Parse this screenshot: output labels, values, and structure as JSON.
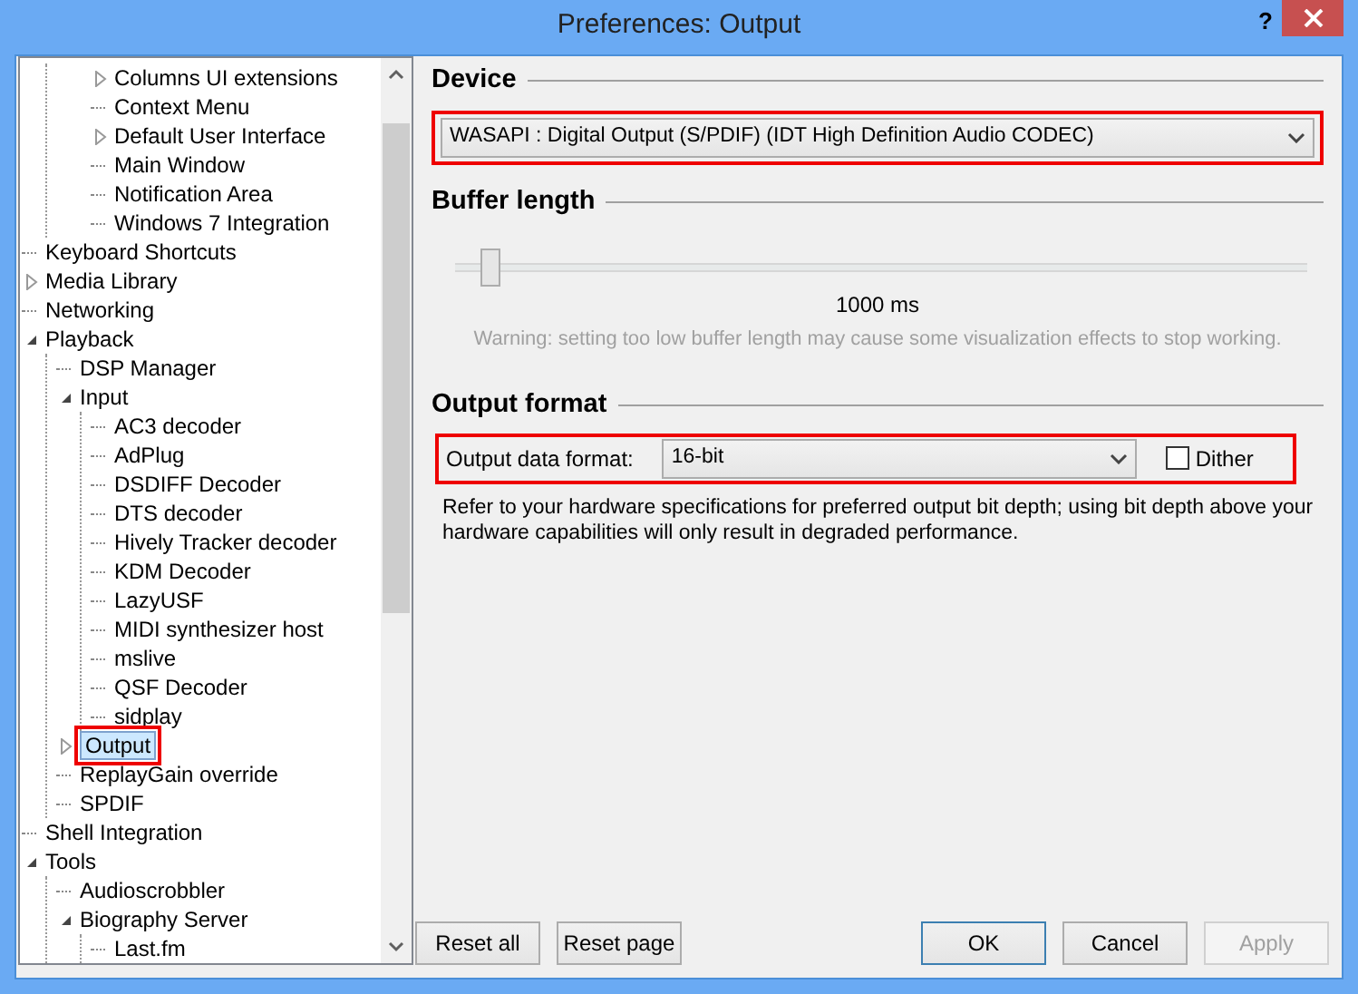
{
  "window": {
    "title": "Preferences: Output",
    "help_glyph": "?"
  },
  "tree": {
    "items": [
      {
        "children": [
          {
            "label": "Columns UI extensions",
            "expanded": false,
            "selected": false
          },
          {
            "label": "Context Menu",
            "selected": false
          },
          {
            "label": "Default User Interface",
            "expanded": false,
            "selected": false
          },
          {
            "label": "Main Window",
            "selected": false
          },
          {
            "label": "Notification Area",
            "selected": false
          },
          {
            "label": "Windows 7 Integration",
            "selected": false
          }
        ]
      },
      {
        "label": "Keyboard Shortcuts",
        "selected": false
      },
      {
        "label": "Media Library",
        "expanded": false,
        "selected": false
      },
      {
        "label": "Networking",
        "selected": false
      },
      {
        "label": "Playback",
        "expanded": true,
        "selected": false,
        "children": [
          {
            "label": "DSP Manager",
            "selected": false
          },
          {
            "label": "Input",
            "expanded": true,
            "selected": false,
            "children": [
              {
                "label": "AC3 decoder",
                "selected": false
              },
              {
                "label": "AdPlug",
                "selected": false
              },
              {
                "label": "DSDIFF Decoder",
                "selected": false
              },
              {
                "label": "DTS decoder",
                "selected": false
              },
              {
                "label": "Hively Tracker decoder",
                "selected": false
              },
              {
                "label": "KDM Decoder",
                "selected": false
              },
              {
                "label": "LazyUSF",
                "selected": false
              },
              {
                "label": "MIDI synthesizer host",
                "selected": false
              },
              {
                "label": "mslive",
                "selected": false
              },
              {
                "label": "QSF Decoder",
                "selected": false
              },
              {
                "label": "sidplay",
                "selected": false
              }
            ]
          },
          {
            "label": "Output",
            "expanded": false,
            "selected": true,
            "highlighted": true
          },
          {
            "label": "ReplayGain override",
            "selected": false
          },
          {
            "label": "SPDIF",
            "selected": false
          }
        ]
      },
      {
        "label": "Shell Integration",
        "selected": false
      },
      {
        "label": "Tools",
        "expanded": true,
        "selected": false,
        "children": [
          {
            "label": "Audioscrobbler",
            "selected": false
          },
          {
            "label": "Biography Server",
            "expanded": true,
            "selected": false,
            "children": [
              {
                "label": "Last.fm",
                "selected": false
              }
            ]
          }
        ]
      }
    ]
  },
  "device": {
    "heading": "Device",
    "value": "WASAPI : Digital Output (S/PDIF) (IDT High Definition Audio CODEC)",
    "highlighted": true
  },
  "buffer": {
    "heading": "Buffer length",
    "level": 0.04,
    "reading": "1000 ms",
    "warning": "Warning: setting too low buffer length may cause some visualization effects to stop working."
  },
  "output_format": {
    "heading": "Output format",
    "label": "Output data format:",
    "value": "16-bit",
    "dither": {
      "label": "Dither",
      "checked": false
    },
    "highlighted": true,
    "note": "Refer to your hardware specifications for preferred output bit depth; using bit depth above your hardware capabilities will only result in degraded performance."
  },
  "buttons": [
    {
      "label": "Reset all",
      "kind": "left",
      "focused": false,
      "disabled": false
    },
    {
      "label": "Reset page",
      "kind": "left",
      "focused": false,
      "disabled": false
    },
    {
      "label": "OK",
      "kind": "right",
      "focused": true,
      "disabled": false
    },
    {
      "label": "Cancel",
      "kind": "right",
      "focused": false,
      "disabled": false
    },
    {
      "label": "Apply",
      "kind": "right",
      "focused": false,
      "disabled": true
    }
  ]
}
